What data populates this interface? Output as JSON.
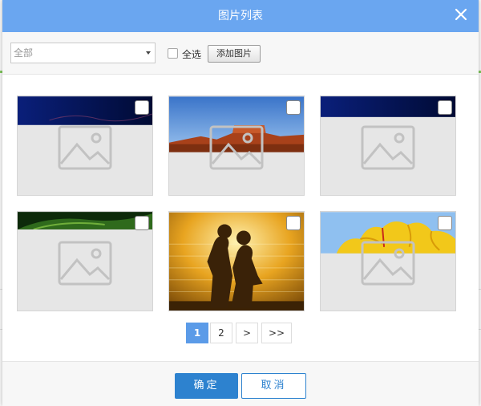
{
  "dialog": {
    "title": "图片列表",
    "close_icon": "close-icon"
  },
  "toolbar": {
    "category_select": {
      "value": "全部"
    },
    "select_all_label": "全选",
    "add_image_label": "添加图片"
  },
  "images": [
    {
      "name": "image-1",
      "checked": false,
      "photo": "dark-blue-banner"
    },
    {
      "name": "image-2",
      "checked": false,
      "photo": "desert-mesa"
    },
    {
      "name": "image-3",
      "checked": false,
      "photo": "dark-blue-banner"
    },
    {
      "name": "image-4",
      "checked": false,
      "photo": "green-leaf"
    },
    {
      "name": "image-5",
      "checked": false,
      "photo": "couple-silhouette-sunset"
    },
    {
      "name": "image-6",
      "checked": false,
      "photo": "yellow-tulips"
    }
  ],
  "pagination": {
    "pages": [
      "1",
      "2"
    ],
    "current": "1",
    "next_label": ">",
    "last_label": ">>"
  },
  "footer": {
    "confirm_label": "确定",
    "cancel_label": "取消"
  },
  "colors": {
    "title_bar": "#6aa6f0",
    "primary_button": "#2d82cf",
    "active_page": "#5b9be8"
  }
}
